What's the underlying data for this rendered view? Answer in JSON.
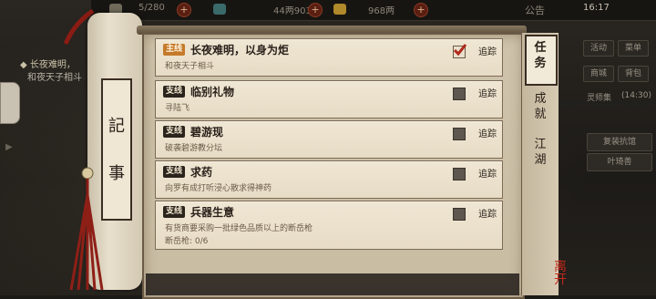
{
  "hud": {
    "stamina": "5/280",
    "copper": "44两903文",
    "silver": "968两",
    "notice": "公告",
    "time": "16:17"
  },
  "tracker": {
    "quest_title": "◆ 长夜难明，",
    "quest_sub": "和夜天子相斗"
  },
  "side_panel": {
    "buttons": [
      "活动",
      "菜单",
      "商城",
      "背包"
    ],
    "spirit_label": "灵师集",
    "spirit_time": "(14:30)",
    "rows": [
      "复装抗馆",
      "叶琦善"
    ]
  },
  "scroll": {
    "chars": [
      "記",
      "事"
    ]
  },
  "quests": [
    {
      "tag": "主线",
      "tag_type": "main",
      "title": "长夜难明，以身为炬",
      "desc": "和夜天子相斗",
      "extra": "",
      "tracked": true,
      "track_label": "追踪"
    },
    {
      "tag": "支线",
      "tag_type": "side",
      "title": "临别礼物",
      "desc": "寻陆飞",
      "extra": "",
      "tracked": false,
      "track_label": "追踪"
    },
    {
      "tag": "支线",
      "tag_type": "side",
      "title": "碧游现",
      "desc": "破袭碧游教分坛",
      "extra": "",
      "tracked": false,
      "track_label": "追踪"
    },
    {
      "tag": "支线",
      "tag_type": "side",
      "title": "求药",
      "desc": "向罗有成打听浸心散求得神药",
      "extra": "",
      "tracked": false,
      "track_label": "追踪"
    },
    {
      "tag": "支线",
      "tag_type": "side",
      "title": "兵器生意",
      "desc": "有货商要采购一批绿色品质以上的断岳枪",
      "extra": "断岳枪: 0/6",
      "tracked": false,
      "track_label": "追踪"
    }
  ],
  "tabs": [
    {
      "label": "任\n务",
      "active": true
    },
    {
      "label": "成\n就",
      "active": false
    },
    {
      "label": "江\n湖",
      "active": false
    }
  ],
  "seal": "离开"
}
